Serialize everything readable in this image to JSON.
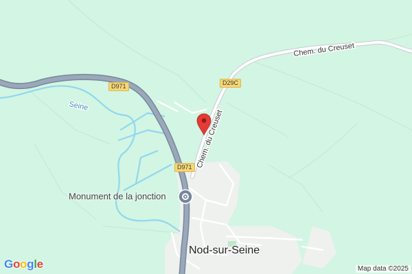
{
  "map": {
    "places": {
      "town": "Nod-sur-Seine",
      "monument": "Monument de la jonction"
    },
    "water": {
      "river": "Seine"
    },
    "roads": {
      "d971_top": "D971",
      "d971_mid": "D971",
      "d29c": "D29C",
      "chem_top": "Chem. du Creuset",
      "chem_diag": "Chem. du Creuset"
    },
    "attribution": "Map data ©2025",
    "logo": "Google",
    "colors": {
      "land": "#d3f5e3",
      "water": "#8fd8ee",
      "main_road": "#8c9aad",
      "minor_road": "#ffffff",
      "urban": "#eef1ee",
      "marker": "#e33b35"
    }
  }
}
